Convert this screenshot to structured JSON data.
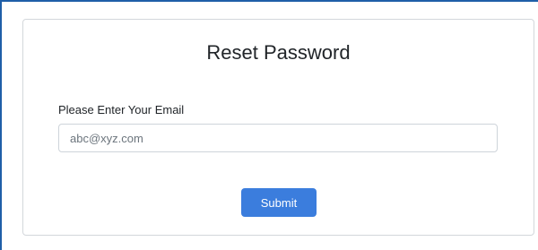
{
  "form": {
    "title": "Reset Password",
    "email_label": "Please Enter Your Email",
    "email_placeholder": "abc@xyz.com",
    "email_value": "",
    "submit_label": "Submit"
  },
  "colors": {
    "primary_button": "#3b7ddd",
    "frame_border": "#1f5fa8"
  }
}
